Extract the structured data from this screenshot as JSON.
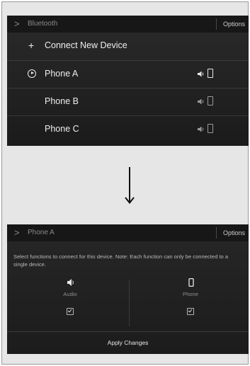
{
  "top_screen": {
    "header": {
      "chevron": ">",
      "title": "Bluetooth",
      "options_label": "Options"
    },
    "connect_row": {
      "icon": "+",
      "label": "Connect New Device"
    },
    "devices": [
      {
        "label": "Phone A",
        "active": true,
        "icons": [
          "speaker-icon",
          "phone-icon"
        ]
      },
      {
        "label": "Phone B",
        "active": false,
        "icons": [
          "speaker-icon",
          "phone-icon"
        ]
      },
      {
        "label": "Phone C",
        "active": false,
        "icons": [
          "speaker-icon",
          "phone-icon"
        ]
      }
    ]
  },
  "arrow": {
    "icon": "arrow-down-icon"
  },
  "bottom_screen": {
    "header": {
      "chevron": ">",
      "title": "Phone A",
      "options_label": "Options"
    },
    "instruction": "Select functions to connect for this device. Note: Each function can only be connected to a single device.",
    "functions": [
      {
        "label": "Audio",
        "icon": "speaker-icon",
        "checked": true
      },
      {
        "label": "Phone",
        "icon": "phone-icon",
        "checked": true
      }
    ],
    "apply_label": "Apply Changes"
  },
  "colors": {
    "screen_bg": "#222222",
    "text": "#eeeeee",
    "muted_text": "#8a8a8a"
  }
}
